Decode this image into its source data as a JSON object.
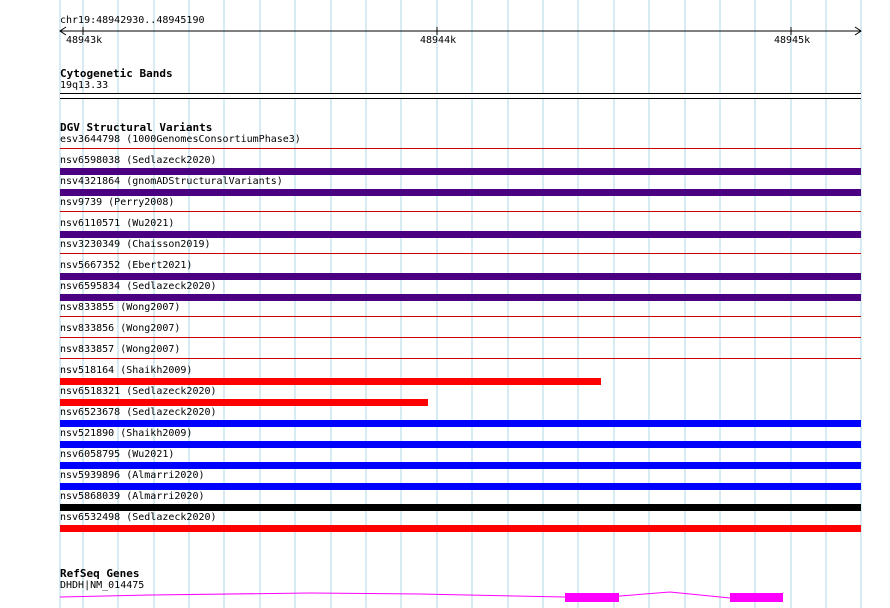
{
  "ruler": {
    "location": "chr19:48942930..48945190",
    "ticks": [
      "48943k",
      "48944k",
      "48945k"
    ]
  },
  "cytogenetic": {
    "title": "Cytogenetic Bands",
    "band": "19q13.33"
  },
  "dgv": {
    "title": "DGV Structural Variants",
    "variants": [
      {
        "id": "esv3644798 (1000GenomesConsortiumPhase3)",
        "color": "#cc0000",
        "bar": false
      },
      {
        "id": "nsv6598038 (Sedlazeck2020)",
        "color": "#4b0082",
        "bar": true,
        "start": 0.0,
        "end": 1.0
      },
      {
        "id": "nsv4321864 (gnomADStructuralVariants)",
        "color": "#4b0082",
        "bar": true,
        "start": 0.0,
        "end": 1.0
      },
      {
        "id": "nsv9739 (Perry2008)",
        "color": "#cc0000",
        "bar": false
      },
      {
        "id": "nsv6110571 (Wu2021)",
        "color": "#4b0082",
        "bar": true,
        "start": 0.0,
        "end": 1.0
      },
      {
        "id": "nsv3230349 (Chaisson2019)",
        "color": "#cc0000",
        "bar": false
      },
      {
        "id": "nsv5667352 (Ebert2021)",
        "color": "#4b0082",
        "bar": true,
        "start": 0.0,
        "end": 1.0
      },
      {
        "id": "nsv6595834 (Sedlazeck2020)",
        "color": "#4b0082",
        "bar": true,
        "start": 0.0,
        "end": 1.0
      },
      {
        "id": "nsv833855 (Wong2007)",
        "color": "#cc0000",
        "bar": false
      },
      {
        "id": "nsv833856 (Wong2007)",
        "color": "#cc0000",
        "bar": false
      },
      {
        "id": "nsv833857 (Wong2007)",
        "color": "#cc0000",
        "bar": false
      },
      {
        "id": "nsv518164 (Shaikh2009)",
        "color": "#ff0000",
        "bar": true,
        "start": 0.0,
        "end": 0.676
      },
      {
        "id": "nsv6518321 (Sedlazeck2020)",
        "color": "#ff0000",
        "bar": true,
        "start": 0.0,
        "end": 0.459
      },
      {
        "id": "nsv6523678 (Sedlazeck2020)",
        "color": "#0000ff",
        "bar": true,
        "start": 0.0,
        "end": 1.0
      },
      {
        "id": "nsv521890 (Shaikh2009)",
        "color": "#0000ff",
        "bar": true,
        "start": 0.0,
        "end": 1.0
      },
      {
        "id": "nsv6058795 (Wu2021)",
        "color": "#0000ff",
        "bar": true,
        "start": 0.0,
        "end": 1.0
      },
      {
        "id": "nsv5939896 (Almarri2020)",
        "color": "#0000ff",
        "bar": true,
        "start": 0.0,
        "end": 1.0
      },
      {
        "id": "nsv5868039 (Almarri2020)",
        "color": "#000000",
        "bar": true,
        "start": 0.0,
        "end": 1.0
      },
      {
        "id": "nsv6532498 (Sedlazeck2020)",
        "color": "#ff0000",
        "bar": true,
        "start": 0.0,
        "end": 1.0
      }
    ]
  },
  "refseq": {
    "title": "RefSeq Genes",
    "gene": "DHDH|NM_014475",
    "color": "#ff00ff"
  },
  "colors": {
    "grid": "#add8e6",
    "ruler": "#000000",
    "separator": "#cc0000",
    "background": "#ffffff"
  }
}
